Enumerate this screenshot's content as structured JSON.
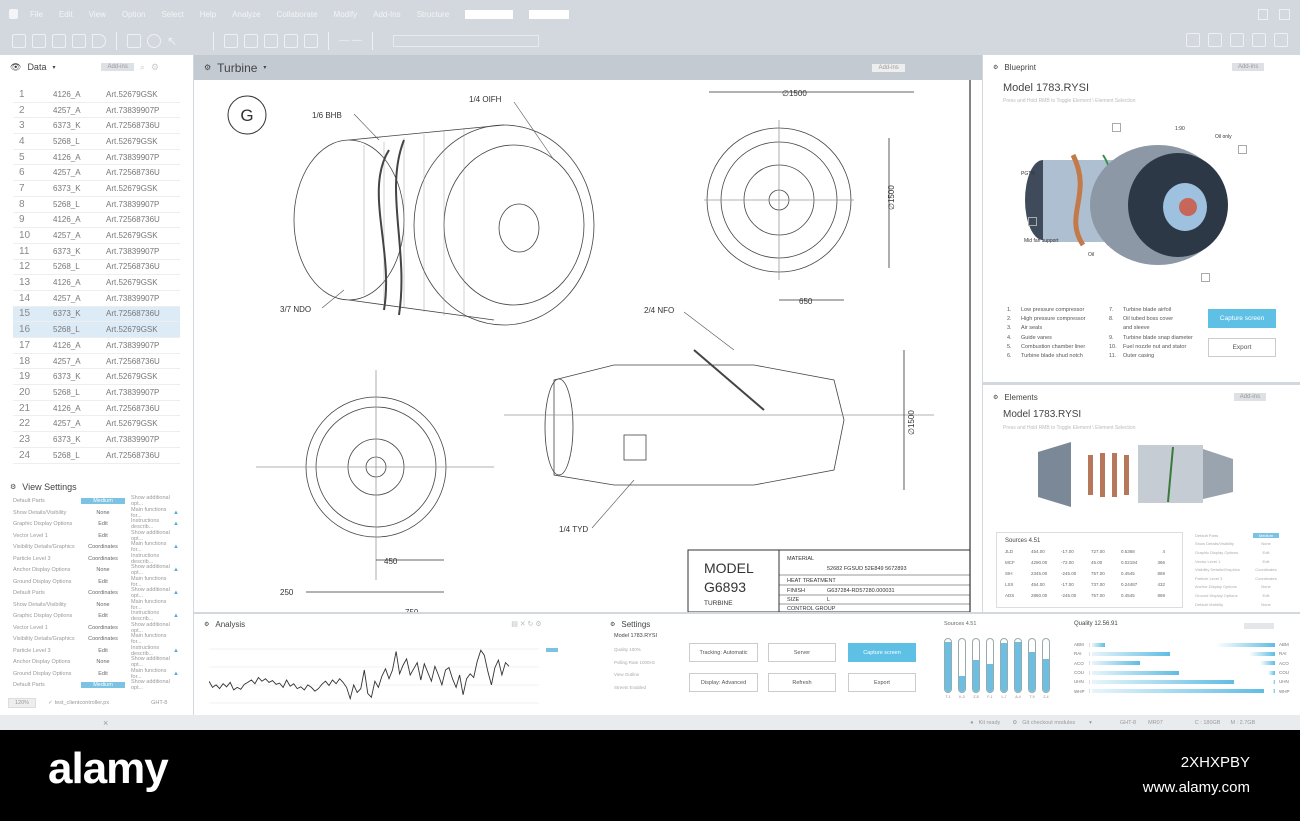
{
  "menu": [
    "File",
    "Edit",
    "View",
    "Option",
    "Select",
    "Help",
    "Analyze",
    "Collaborate",
    "Modify",
    "Add-Ins",
    "Structure"
  ],
  "data_panel": {
    "title": "Data",
    "addins": "Add-ins",
    "rows": [
      [
        "1",
        "4126_A",
        "Art.52679GSK"
      ],
      [
        "2",
        "4257_A",
        "Art.73839907P"
      ],
      [
        "3",
        "6373_K",
        "Art.72568736U"
      ],
      [
        "4",
        "5268_L",
        "Art.52679GSK"
      ],
      [
        "5",
        "4126_A",
        "Art.73839907P"
      ],
      [
        "6",
        "4257_A",
        "Art.72568736U"
      ],
      [
        "7",
        "6373_K",
        "Art.52679GSK"
      ],
      [
        "8",
        "5268_L",
        "Art.73839907P"
      ],
      [
        "9",
        "4126_A",
        "Art.72568736U"
      ],
      [
        "10",
        "4257_A",
        "Art.52679GSK"
      ],
      [
        "11",
        "6373_K",
        "Art.73839907P"
      ],
      [
        "12",
        "5268_L",
        "Art.72568736U"
      ],
      [
        "13",
        "4126_A",
        "Art.52679GSK"
      ],
      [
        "14",
        "4257_A",
        "Art.73839907P"
      ],
      [
        "15",
        "6373_K",
        "Art.72568736U"
      ],
      [
        "16",
        "5268_L",
        "Art.52679GSK"
      ],
      [
        "17",
        "4126_A",
        "Art.73839907P"
      ],
      [
        "18",
        "4257_A",
        "Art.72568736U"
      ],
      [
        "19",
        "6373_K",
        "Art.52679GSK"
      ],
      [
        "20",
        "5268_L",
        "Art.73839907P"
      ],
      [
        "21",
        "4126_A",
        "Art.72568736U"
      ],
      [
        "22",
        "4257_A",
        "Art.52679GSK"
      ],
      [
        "23",
        "6373_K",
        "Art.73839907P"
      ],
      [
        "24",
        "5268_L",
        "Art.72568736U"
      ]
    ],
    "selected": [
      15,
      16
    ]
  },
  "view_settings": {
    "title": "View Settings",
    "rows": [
      [
        "Default Parts",
        "Medium",
        "Show additional opt..."
      ],
      [
        "Show Details/Visibility",
        "None",
        "Main functions for..."
      ],
      [
        "Graphic Display Options",
        "Edit",
        "Instructions describ..."
      ],
      [
        "Vector Level 1",
        "Edit",
        "Show additional opt..."
      ],
      [
        "Visibility Details/Graphics",
        "Coordinates",
        "Main functions for..."
      ],
      [
        "Particle Level 3",
        "Coordinates",
        "Instructions describ..."
      ],
      [
        "Anchor Display Options",
        "None",
        "Show additional opt..."
      ],
      [
        "Ground Display Options",
        "Edit",
        "Main functions for..."
      ],
      [
        "Default Parts",
        "Coordinates",
        "Show additional opt..."
      ],
      [
        "Show Details/Visibility",
        "None",
        "Main functions for..."
      ],
      [
        "Graphic Display Options",
        "Edit",
        "Instructions describ..."
      ],
      [
        "Vector Level 1",
        "Coordinates",
        "Show additional opt..."
      ],
      [
        "Visibility Details/Graphics",
        "Coordinates",
        "Main functions for..."
      ],
      [
        "Particle Level 3",
        "Edit",
        "Instructions describ..."
      ],
      [
        "Anchor Display Options",
        "None",
        "Show additional opt..."
      ],
      [
        "Ground Display Options",
        "Edit",
        "Main functions for..."
      ],
      [
        "Default Parts",
        "Medium",
        "Show additional opt..."
      ]
    ],
    "warn_rows": [
      1,
      2,
      4,
      6,
      8,
      10,
      13,
      15
    ],
    "zoom": "120%",
    "file": "test_clientcontroller.px",
    "code": "GHT-8"
  },
  "turbine": {
    "title": "Turbine",
    "addins": "Add-ins",
    "badge": "G",
    "callouts": {
      "bhb": "1/6 BHB",
      "oifh": "1/4 OIFH",
      "ndo": "3/7 NDO",
      "nfo": "2/4 NFO",
      "tyd": "1/4 TYD"
    },
    "dims": {
      "d1500a": "∅1500",
      "d1500b": "∅1500",
      "d1500c": "∅1500",
      "w650": "650",
      "w450": "450",
      "w250": "250",
      "w750": "750"
    },
    "title_block": {
      "model": "MODEL",
      "number": "G6893",
      "type": "TURBINE",
      "material_label": "MATERIAL",
      "material": "52682    FGSUD 52E849    5672893",
      "heat": "HEAT TREATMENT",
      "finish_label": "FINISH",
      "finish": "G637284-RD57280.000031",
      "size_label": "SIZE",
      "size": "L",
      "control": "CONTROL GROUP"
    }
  },
  "blueprint": {
    "title": "Blueprint",
    "addins": "Add-ins",
    "model": "Model 1783.RYSI",
    "hint": "Press and Hold RMB to Toggle Element \\ Element Selection",
    "labels": {
      "a": "1:90",
      "b": "Oil only",
      "c": "PGTR",
      "d": "Mid fan support",
      "e": "Oil"
    },
    "parts": [
      [
        "1.",
        "Low pressure compressor"
      ],
      [
        "2.",
        "High pressure compressor"
      ],
      [
        "3.",
        "Air seals"
      ],
      [
        "4.",
        "Guide vanes"
      ],
      [
        "5.",
        "Combustion chamber liner"
      ],
      [
        "6.",
        "Turbine blade shud notch"
      ]
    ],
    "parts2": [
      [
        "7.",
        "Turbine blade airfoil"
      ],
      [
        "8.",
        "Oil tubed boss cover"
      ],
      [
        "",
        "and sleeve"
      ],
      [
        "9.",
        "Turbine blade snap diameter"
      ],
      [
        "10.",
        "Fuel nozzle nut and stator"
      ],
      [
        "11.",
        "Outer casing"
      ]
    ],
    "capture": "Capture screen",
    "export": "Export"
  },
  "elements": {
    "title": "Elements",
    "addins": "Add-ins",
    "model": "Model 1783.RYSI",
    "hint": "Press and Hold RMB to Toggle Element \\ Element Selection",
    "sources_title": "Sources 4.51",
    "sources": [
      [
        "JLD",
        "454.00",
        "-17.00",
        "727.00",
        "0.5368",
        "4"
      ],
      [
        "MCF",
        "4290.00",
        "-72.00",
        "45.00",
        "0.02194",
        "366"
      ],
      [
        "SIH",
        "2345.00",
        "-245.00",
        "757.00",
        "0.4545",
        "869"
      ],
      [
        "LSX",
        "454.00",
        "-17.00",
        "737.00",
        "0.24487",
        "432"
      ],
      [
        "ADS",
        "2860.00",
        "-245.00",
        "757.00",
        "0.4545",
        "869"
      ]
    ],
    "settings": [
      [
        "Default Parts",
        "Medium"
      ],
      [
        "Show Details/Visibility",
        "None"
      ],
      [
        "Graphic Display Options",
        "Edit"
      ],
      [
        "Vector Level 1",
        "Edit"
      ],
      [
        "Visibility Details/Graphics",
        "Coordinates"
      ],
      [
        "Particle Level 3",
        "Coordinates"
      ],
      [
        "Anchor Display Options",
        "None"
      ],
      [
        "Ground Display Options",
        "Edit"
      ],
      [
        "Default Visibility",
        "None"
      ]
    ]
  },
  "analysis": {
    "title": "Analysis",
    "series": [
      40,
      30,
      34,
      28,
      36,
      31,
      38,
      26,
      30,
      27,
      35,
      38,
      42,
      36,
      46,
      40,
      44,
      38,
      41,
      35,
      37,
      30,
      42,
      32,
      36,
      28,
      31,
      26,
      34,
      30,
      24,
      28,
      35,
      40,
      33,
      42,
      36,
      44,
      38,
      30,
      12,
      34,
      22,
      28,
      58,
      20,
      14,
      40,
      30,
      48,
      60,
      44,
      58,
      88,
      52,
      66,
      76,
      50,
      60,
      70,
      42,
      68,
      54,
      40,
      64,
      50,
      34,
      58,
      62,
      44,
      30,
      50,
      18,
      44,
      52,
      46,
      72,
      90,
      82,
      56,
      34,
      62,
      74,
      50,
      70,
      64
    ]
  },
  "settings": {
    "title": "Settings",
    "model": "Model 1783.RYSI",
    "lines": [
      "Quality 100%",
      "Polling Rate 1000Hz",
      "View Outline",
      "Streets Enabled"
    ],
    "buttons": {
      "tracking": "Tracking: Automatic",
      "server": "Server",
      "capture": "Capture screen",
      "display": "Display: Advanced",
      "refresh": "Refresh",
      "export": "Export"
    }
  },
  "sources_bars": {
    "title": "Sources 4.51",
    "labels": [
      "T-1",
      "K-3",
      "Z-8",
      "F-1",
      "L-7",
      "A-4",
      "T-9",
      "Z-4"
    ],
    "values": [
      0.95,
      0.3,
      0.6,
      0.52,
      0.92,
      0.95,
      0.75,
      0.62
    ]
  },
  "quality": {
    "title": "Quality 12.56.91",
    "categories": [
      "ABM",
      "RAI",
      "ACO",
      "COU",
      "UHN",
      "WHP"
    ],
    "values": [
      0.07,
      0.42,
      0.26,
      0.47,
      0.77,
      0.93
    ],
    "right_values": [
      0.32,
      0.14,
      0.08,
      0.04,
      0.01,
      0.01
    ]
  },
  "status": {
    "kit": "Kit ready",
    "git": "Git checkout modules",
    "code1": "GHT-8",
    "code2": "MR07",
    "disk": "C : 180GB",
    "mem": "M : 2.7GB"
  },
  "watermark": {
    "brand": "alamy",
    "id": "2XHXPBY",
    "url": "www.alamy.com"
  },
  "colors": {
    "accent": "#5fc0e6",
    "chrome": "#d3d8de"
  }
}
